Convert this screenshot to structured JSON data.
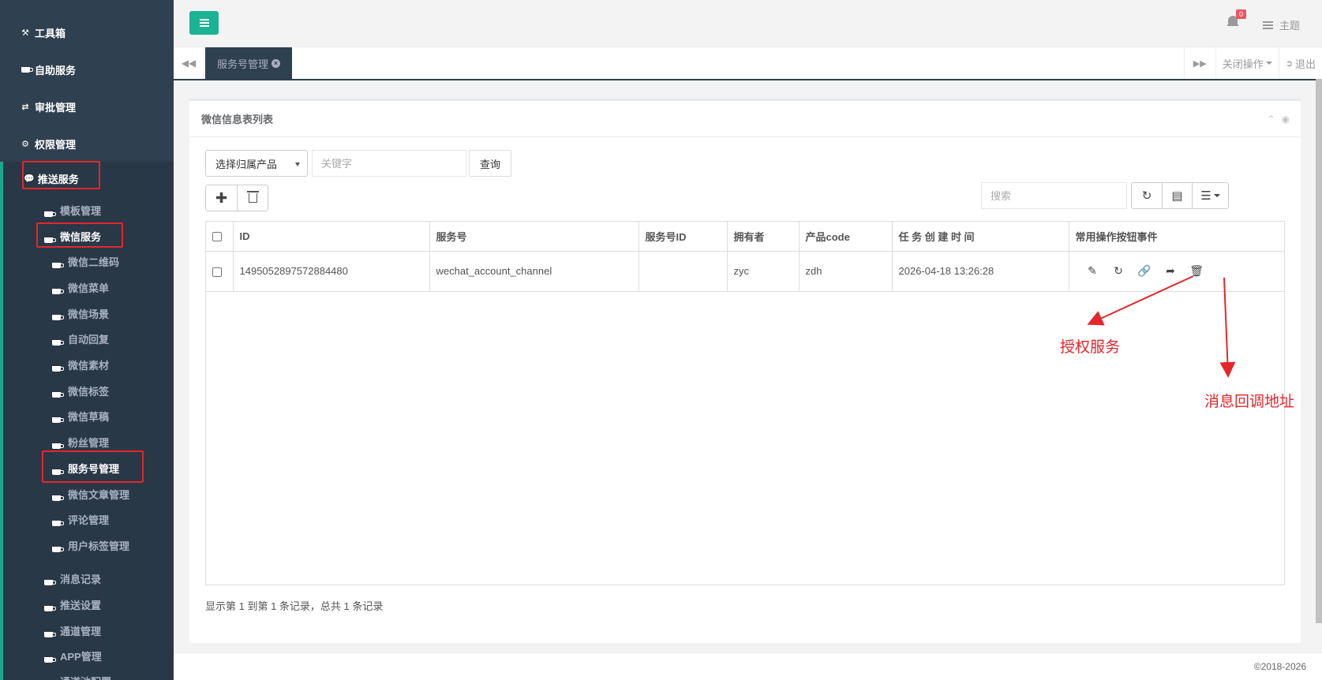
{
  "sidebar": {
    "top_items": [
      {
        "label": "工具箱",
        "icon": "wrench-icon"
      },
      {
        "label": "自助服务",
        "icon": "coffee-icon"
      },
      {
        "label": "审批管理",
        "icon": "exchange-icon"
      },
      {
        "label": "权限管理",
        "icon": "gear-icon"
      }
    ],
    "push_service": "推送服务",
    "template_mgmt": "模板管理",
    "wechat_service": "微信服务",
    "wechat_sub": [
      "微信二维码",
      "微信菜单",
      "微信场景",
      "自动回复",
      "微信素材",
      "微信标签",
      "微信草稿",
      "粉丝管理",
      "服务号管理",
      "微信文章管理",
      "评论管理",
      "用户标签管理"
    ],
    "bottom_items": [
      "消息记录",
      "推送设置",
      "通道管理",
      "APP管理",
      "通道池配置"
    ]
  },
  "header": {
    "notification_count": "0",
    "theme_label": "主题"
  },
  "tabs": {
    "active_tab": "服务号管理",
    "close_ops": "关闭操作",
    "logout": "退出"
  },
  "panel": {
    "title": "微信信息表列表",
    "product_select": "选择归属产品",
    "keyword_placeholder": "关键字",
    "query_button": "查询",
    "search_placeholder": "搜索"
  },
  "table": {
    "columns": [
      "ID",
      "服务号",
      "服务号ID",
      "拥有者",
      "产品code",
      "任 务 创 建 时 间",
      "常用操作按钮事件"
    ],
    "rows": [
      {
        "id": "1495052897572884480",
        "account": "wechat_account_channel",
        "account_id": "",
        "owner": "zyc",
        "product_code": "zdh",
        "created": "2026-04-18 13:26:28"
      }
    ],
    "row_action_icons": [
      "edit-icon",
      "refresh-icon",
      "link-icon",
      "share-icon",
      "trash-icon"
    ]
  },
  "pagination_info": "显示第 1 到第 1 条记录，总共 1 条记录",
  "annotations": {
    "auth_service": "授权服务",
    "callback_url": "消息回调地址",
    "color": "#e4262b"
  },
  "copyright": "©2018-2026",
  "colors": {
    "sidebar_bg": "#2f4050",
    "accent": "#1ab394"
  }
}
